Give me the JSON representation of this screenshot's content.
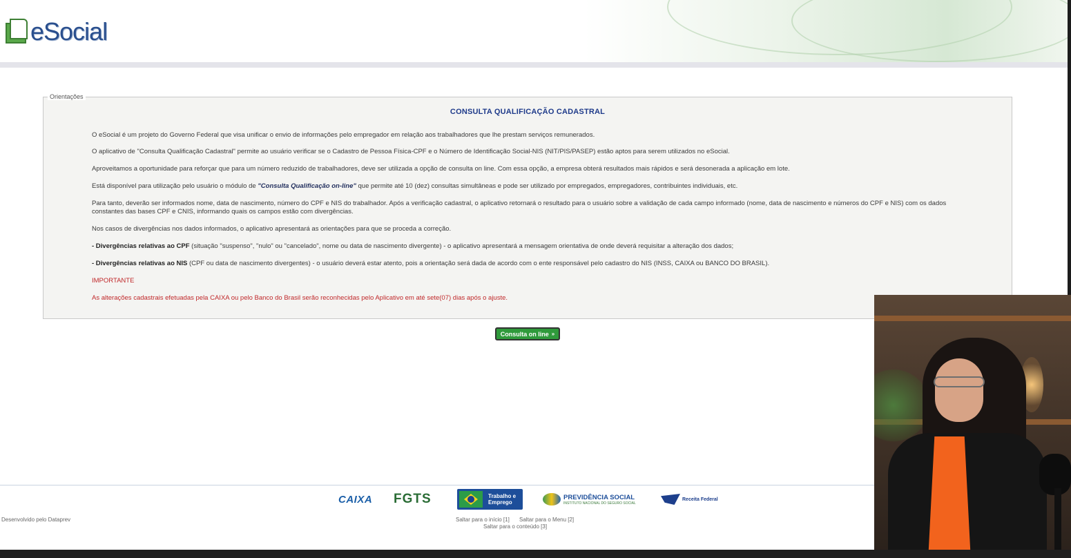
{
  "header": {
    "logo_text": "eSocial"
  },
  "guidance": {
    "legend": "Orientações",
    "title": "CONSULTA QUALIFICAÇÃO CADASTRAL",
    "p1": "O eSocial é um projeto do Governo Federal que visa unificar o envio de informações pelo empregador em relação aos trabalhadores que lhe prestam serviços remunerados.",
    "p2": "O aplicativo de \"Consulta Qualificação Cadastral\" permite ao usuário verificar se o Cadastro de Pessoa Física-CPF e o Número de Identificação Social-NIS (NIT/PIS/PASEP) estão aptos para serem utilizados no eSocial.",
    "p3": "Aproveitamos a oportunidade para reforçar que para um número reduzido de trabalhadores, deve ser utilizada a opção de consulta on line. Com essa opção, a empresa obterá resultados mais rápidos e será desonerada a aplicação em lote.",
    "p4_pre": "Está disponível para utilização pelo usuário o módulo de ",
    "p4_em": "\"Consulta Qualificação on-line\"",
    "p4_post": " que permite até 10 (dez) consultas simultâneas e pode ser utilizado por empregados, empregadores, contribuintes individuais, etc.",
    "p5": "Para tanto, deverão ser informados nome, data de nascimento, número do CPF e NIS do trabalhador. Após a verificação cadastral, o aplicativo retornará o resultado para o usuário sobre a validação de cada campo informado (nome, data de nascimento e números do CPF e NIS) com os dados constantes das bases CPF e CNIS, informando quais os campos estão com divergências.",
    "p6": "Nos casos de divergências nos dados informados, o aplicativo apresentará as orientações para que se proceda a correção.",
    "p7_pre": "- Divergências relativas ao CPF",
    "p7_post": " (situação \"suspenso\", \"nulo\" ou \"cancelado\", nome ou data de nascimento divergente) - o aplicativo apresentará a mensagem orientativa de onde deverá requisitar a alteração dos dados;",
    "p8_pre": "- Divergências relativas ao NIS",
    "p8_post": " (CPF ou data de nascimento divergentes) - o usuário deverá estar atento, pois a orientação será dada de acordo com o ente responsável pelo cadastro do NIS (INSS, CAIXA ou BANCO DO BRASIL).",
    "important_label": "IMPORTANTE",
    "important_text": "As alterações cadastrais efetuadas pela CAIXA ou pelo Banco do Brasil serão reconhecidas pelo Aplicativo em até sete(07) dias após o ajuste."
  },
  "button": {
    "label": "Consulta on line",
    "arrow": "»"
  },
  "footer": {
    "developer": "Desenvolvido pelo Dataprev",
    "partners": {
      "caixa": "CAIXA",
      "fgts": "FGTS",
      "trabalho_line1": "Trabalho e",
      "trabalho_line2": "Emprego",
      "previdencia": "PREVIDÊNCIA SOCIAL",
      "previdencia_sub": "INSTITUTO NACIONAL DO SEGURO SOCIAL",
      "receita": "Receita Federal"
    },
    "link_inicio": "Saltar para o início [1]",
    "link_menu": "Saltar para o Menu [2]",
    "link_conteudo": "Saltar para o conteúdo [3]"
  },
  "colors": {
    "title_blue": "#1e3a8a",
    "important_red": "#c0282a",
    "button_green": "#2f9a3b"
  }
}
